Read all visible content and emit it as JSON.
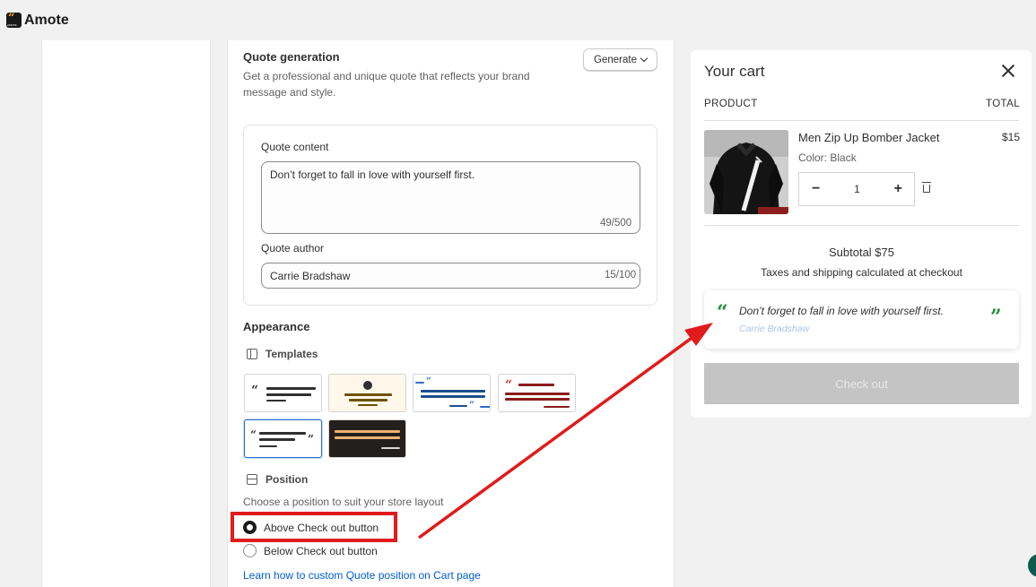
{
  "app": {
    "name": "Amote",
    "logo_text": "AMOTE"
  },
  "quote_generation": {
    "title": "Quote generation",
    "description": "Get a professional and unique quote that reflects your brand message and style.",
    "generate_button": "Generate"
  },
  "quote_form": {
    "content_label": "Quote content",
    "content_value": "Don’t forget to fall in love with yourself first.",
    "content_counter": "49/500",
    "author_label": "Quote author",
    "author_value": "Carrie Bradshaw",
    "author_counter": "15/100"
  },
  "appearance": {
    "title": "Appearance",
    "templates_label": "Templates",
    "templates_count": 6,
    "selected_template_index": 4,
    "position_label": "Position",
    "position_description": "Choose a position to suit your store layout",
    "options": [
      {
        "label": "Above Check out button",
        "selected": true
      },
      {
        "label": "Below Check out button",
        "selected": false
      }
    ],
    "learn_link": "Learn how to custom Quote position on Cart page"
  },
  "cart": {
    "title": "Your cart",
    "col_product": "PRODUCT",
    "col_total": "TOTAL",
    "item": {
      "name": "Men Zip Up Bomber Jacket",
      "price": "$15",
      "variant": "Color: Black",
      "quantity": "1"
    },
    "subtotal": "Subtotal $75",
    "taxes_note": "Taxes and shipping calculated at checkout",
    "quote_text": "Don’t forget to fall in love with yourself first.",
    "quote_author": "Carrie Bradshaw",
    "checkout_label": "Check out"
  },
  "icons": {
    "close": "close-icon",
    "chevron": "chevron-down-icon",
    "templates": "book-icon",
    "position": "layout-icon",
    "trash": "trash-icon",
    "minus": "minus-icon",
    "plus": "plus-icon"
  },
  "colors": {
    "highlight": "#e01b1b",
    "quote_green": "#1f8f3a",
    "link": "#005bd3",
    "selected_template": "#2c6ecb",
    "checkout_disabled": "#c4c4c4"
  }
}
